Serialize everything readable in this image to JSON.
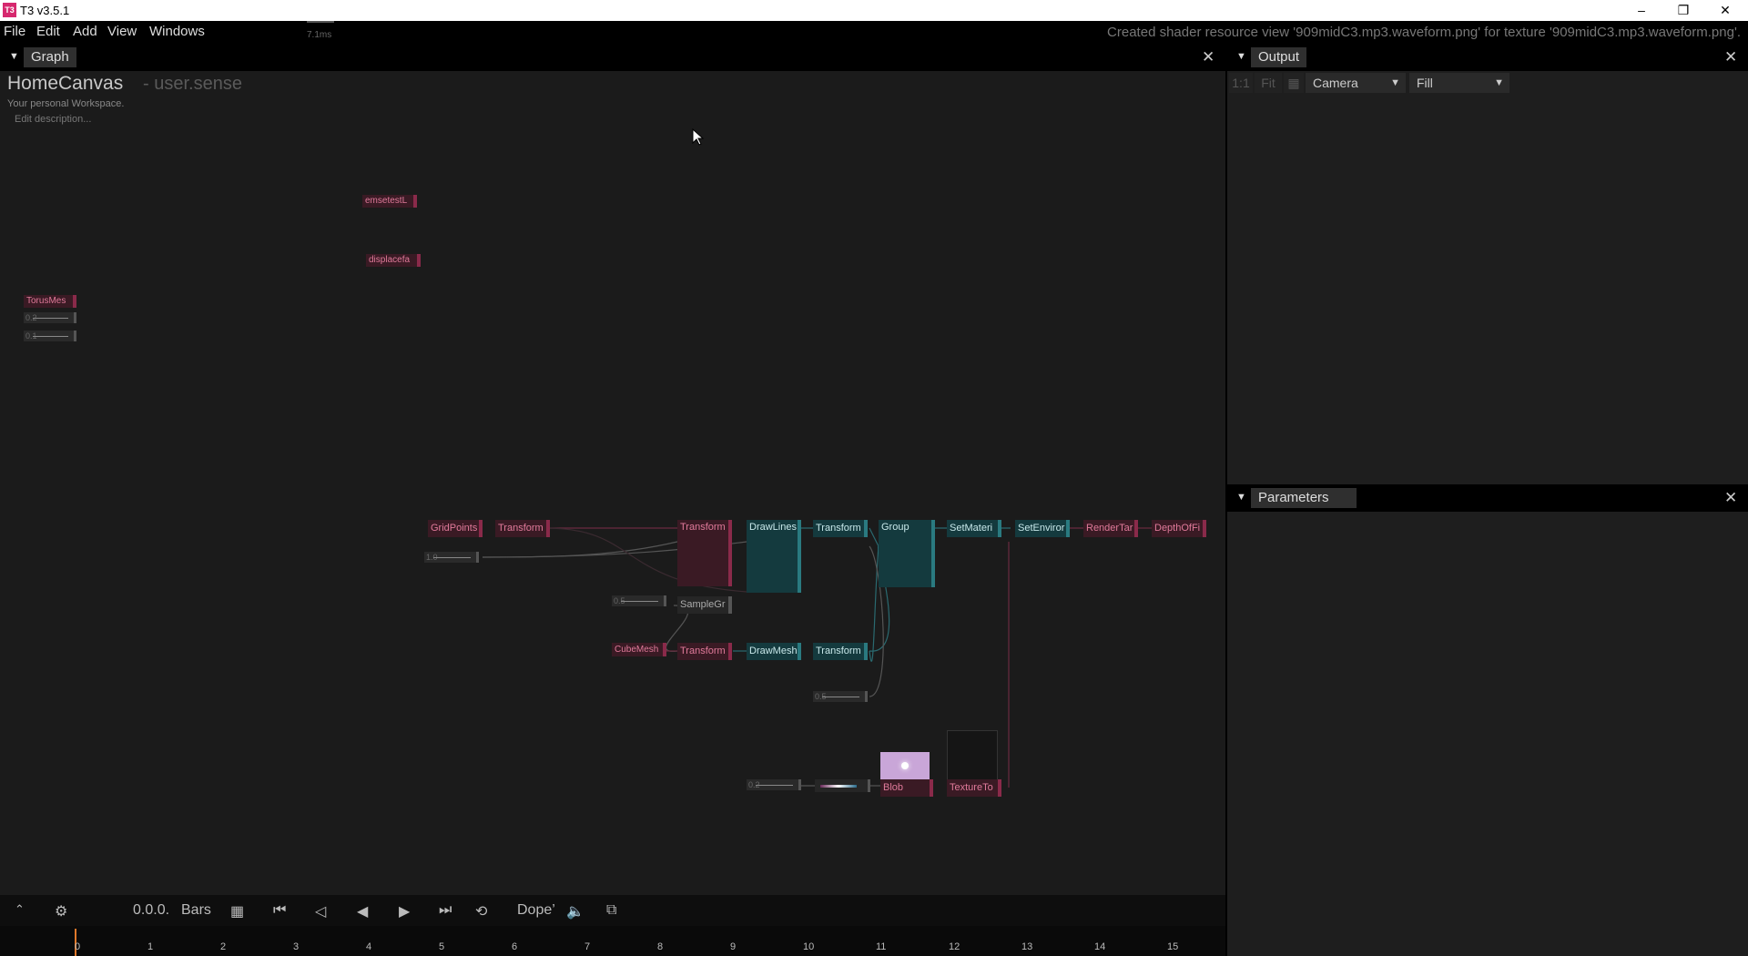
{
  "app": {
    "title": "T3 v3.5.1",
    "logo": "T3"
  },
  "window": {
    "minimize": "–",
    "maximize": "❐",
    "close": "✕"
  },
  "menu": {
    "items": [
      "File",
      "Edit",
      "Add",
      "View",
      "Windows"
    ],
    "fps_label": "7.1ms"
  },
  "status": "Created shader resource view '909midC3.mp3.waveform.png' for texture '909midC3.mp3.waveform.png'.",
  "graph": {
    "tab": "Graph",
    "canvas_title": "HomeCanvas",
    "canvas_subtitle": "- user.sense",
    "description": "Your personal Workspace.",
    "edit_description": "Edit description...",
    "nodes": {
      "n1": "emsetestL",
      "n2": "displacefa",
      "n3": "TorusMes",
      "n4": "GridPoints",
      "n5": "Transform",
      "n6": "Transform",
      "n7": "DrawLines",
      "n8": "Transform",
      "n9": "Group",
      "n10": "SetMateri",
      "n11": "SetEnviror",
      "n12": "RenderTar",
      "n13": "DepthOfFi",
      "n14": "SampleGr",
      "n15": "CubeMesh",
      "n16": "Transform",
      "n17": "DrawMesh",
      "n18": "Transform",
      "n19": "Blob",
      "n20": "TextureTo"
    },
    "sliders": {
      "s1": "0.2",
      "s2": "0.1",
      "s3": "1.0",
      "s4": "0.5",
      "s5": "0.5",
      "s6": "0.2"
    }
  },
  "output": {
    "tab": "Output",
    "tools": {
      "ratio": "1:1",
      "fit": "Fit",
      "camera": "Camera",
      "fill": "Fill"
    }
  },
  "parameters": {
    "tab": "Parameters"
  },
  "timeline": {
    "time": "0.0.0.",
    "unit": "Bars",
    "mode": "Dope’",
    "ticks": [
      "0",
      "1",
      "2",
      "3",
      "4",
      "5",
      "6",
      "7",
      "8",
      "9",
      "10",
      "11",
      "12",
      "13",
      "14",
      "15"
    ]
  }
}
